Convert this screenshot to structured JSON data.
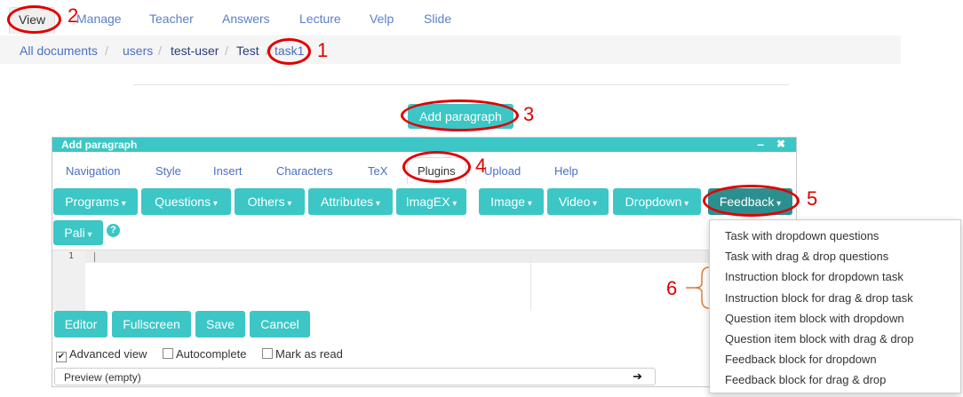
{
  "nav": {
    "items": [
      "View",
      "Manage",
      "Teacher",
      "Answers",
      "Lecture",
      "Velp",
      "Slide"
    ]
  },
  "breadcrumb": {
    "all_documents": "All documents",
    "sep": "/",
    "users": "users",
    "test_user": "test-user",
    "test": "Test",
    "task": "task1"
  },
  "add_paragraph": "Add paragraph",
  "dialog": {
    "title": "Add paragraph",
    "minimize": "–",
    "close": "✖",
    "tabs": [
      "Navigation",
      "Style",
      "Insert",
      "Characters",
      "TeX",
      "Plugins",
      "Upload",
      "Help"
    ],
    "toolbar": [
      "Programs",
      "Questions",
      "Others",
      "Attributes",
      "ImagEX",
      "Image",
      "Video",
      "Dropdown",
      "Feedback"
    ],
    "pali": "Pali",
    "help_icon": "?",
    "line_number": "1",
    "buttons": {
      "editor": "Editor",
      "fullscreen": "Fullscreen",
      "save": "Save",
      "cancel": "Cancel"
    },
    "checkboxes": {
      "advanced": "Advanced view",
      "autocomplete": "Autocomplete",
      "mark_read": "Mark as read"
    },
    "preview": "Preview (empty)",
    "preview_arrow": "➔"
  },
  "feedback_menu": [
    "Task with dropdown questions",
    "Task with drag & drop questions",
    "Instruction block for dropdown task",
    "Instruction block for drag & drop task",
    "Question item block with dropdown",
    "Question item block with drag & drop",
    "Feedback block for dropdown",
    "Feedback block for drag & drop"
  ],
  "annotations": [
    "1",
    "2",
    "3",
    "4",
    "5",
    "6"
  ],
  "colors": {
    "accent": "#3cc6c6",
    "annotation": "#e00000",
    "link": "#4a6fc4"
  }
}
